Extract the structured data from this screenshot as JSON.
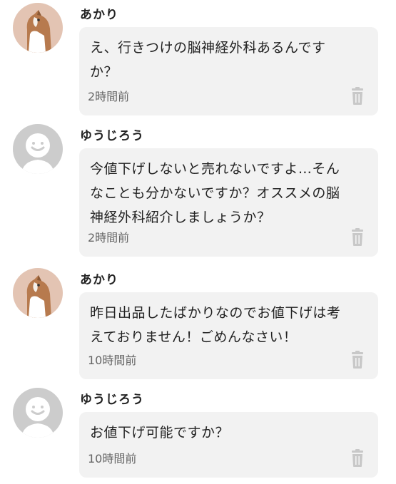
{
  "colors": {
    "bubble_background": "#f2f2f2",
    "default_avatar_background": "#cccccc",
    "cat_avatar_background": "#e3c4b3",
    "trash_icon": "#c8c8c8",
    "timestamp_text": "#666666"
  },
  "messages": [
    {
      "username": "あかり",
      "avatar_icon": "cat-avatar",
      "text": "え、行きつけの脳神経外科あるんですか？",
      "timestamp": "2時間前",
      "action_icon": "trash-icon"
    },
    {
      "username": "ゆうじろう",
      "avatar_icon": "default-smiley-avatar",
      "text": "今値下げしないと売れないですよ…そんなことも分かないですか？オススメの脳神経外科紹介しましょうか？",
      "timestamp": "2時間前",
      "action_icon": "trash-icon"
    },
    {
      "username": "あかり",
      "avatar_icon": "cat-avatar",
      "text": "昨日出品したばかりなのでお値下げは考えておりません！ごめんなさい！",
      "timestamp": "10時間前",
      "action_icon": "trash-icon"
    },
    {
      "username": "ゆうじろう",
      "avatar_icon": "default-smiley-avatar",
      "text": "お値下げ可能ですか？",
      "timestamp": "10時間前",
      "action_icon": "trash-icon"
    }
  ]
}
